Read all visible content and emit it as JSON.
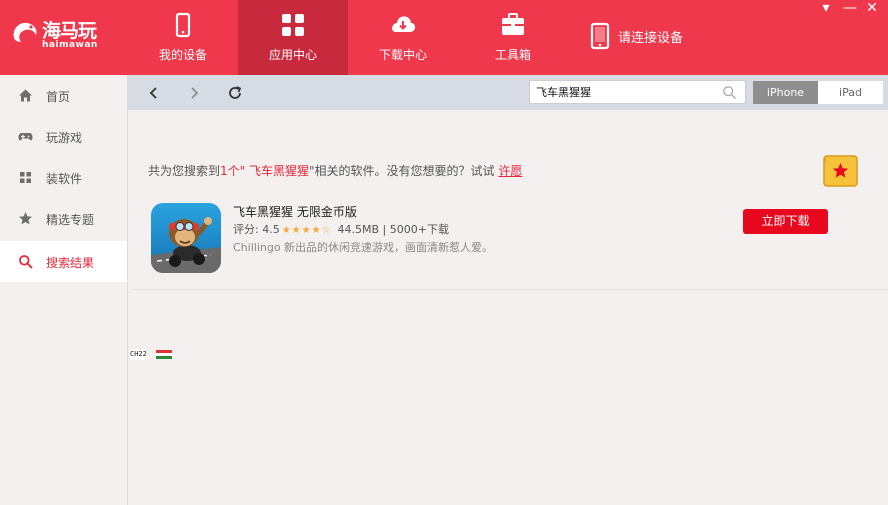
{
  "brand": {
    "name_cn": "海马玩",
    "name_en": "haimawan"
  },
  "nav": {
    "tabs": [
      {
        "label": "我的设备",
        "icon": "phone-icon",
        "active": false
      },
      {
        "label": "应用中心",
        "icon": "app-grid-icon",
        "active": true
      },
      {
        "label": "下载中心",
        "icon": "cloud-download-icon",
        "active": false
      },
      {
        "label": "工具箱",
        "icon": "toolbox-icon",
        "active": false
      }
    ],
    "connect_label": "请连接设备"
  },
  "window_controls": {
    "menu": "▾",
    "minimize": "—",
    "close": "✕"
  },
  "sidebar": {
    "items": [
      {
        "label": "首页",
        "icon": "home-icon",
        "active": false
      },
      {
        "label": "玩游戏",
        "icon": "gamepad-icon",
        "active": false
      },
      {
        "label": "装软件",
        "icon": "apps-icon",
        "active": false
      },
      {
        "label": "精选专题",
        "icon": "star-icon",
        "active": false
      },
      {
        "label": "搜索结果",
        "icon": "search-icon",
        "active": true
      }
    ]
  },
  "toolbar": {
    "search_value": "飞车黑猩猩",
    "device_options": [
      "iPhone",
      "iPad"
    ],
    "selected_device": "iPhone"
  },
  "results": {
    "summary_prefix": "共为您搜索到",
    "summary_count": "1个\"",
    "summary_keyword": " 飞车黑猩猩",
    "summary_mid": "\"相关的软件。没有您想要的？试试 ",
    "wish_link": "许愿",
    "items": [
      {
        "name": "飞车黑猩猩 无限金币版",
        "rating_label": "评分: 4.5",
        "rating": 4.5,
        "size_downloads": "44.5MB | 5000+下载",
        "description": "Chillingo 新出品的休闲竞速游戏，画面清新惹人爱。",
        "download_label": "立即下载"
      }
    ]
  },
  "ime": {
    "text": "CH22"
  },
  "colors": {
    "brand_red": "#f0384c",
    "active_tab": "#c8293d",
    "download_red": "#e8091f",
    "accent_text": "#e4283a"
  }
}
